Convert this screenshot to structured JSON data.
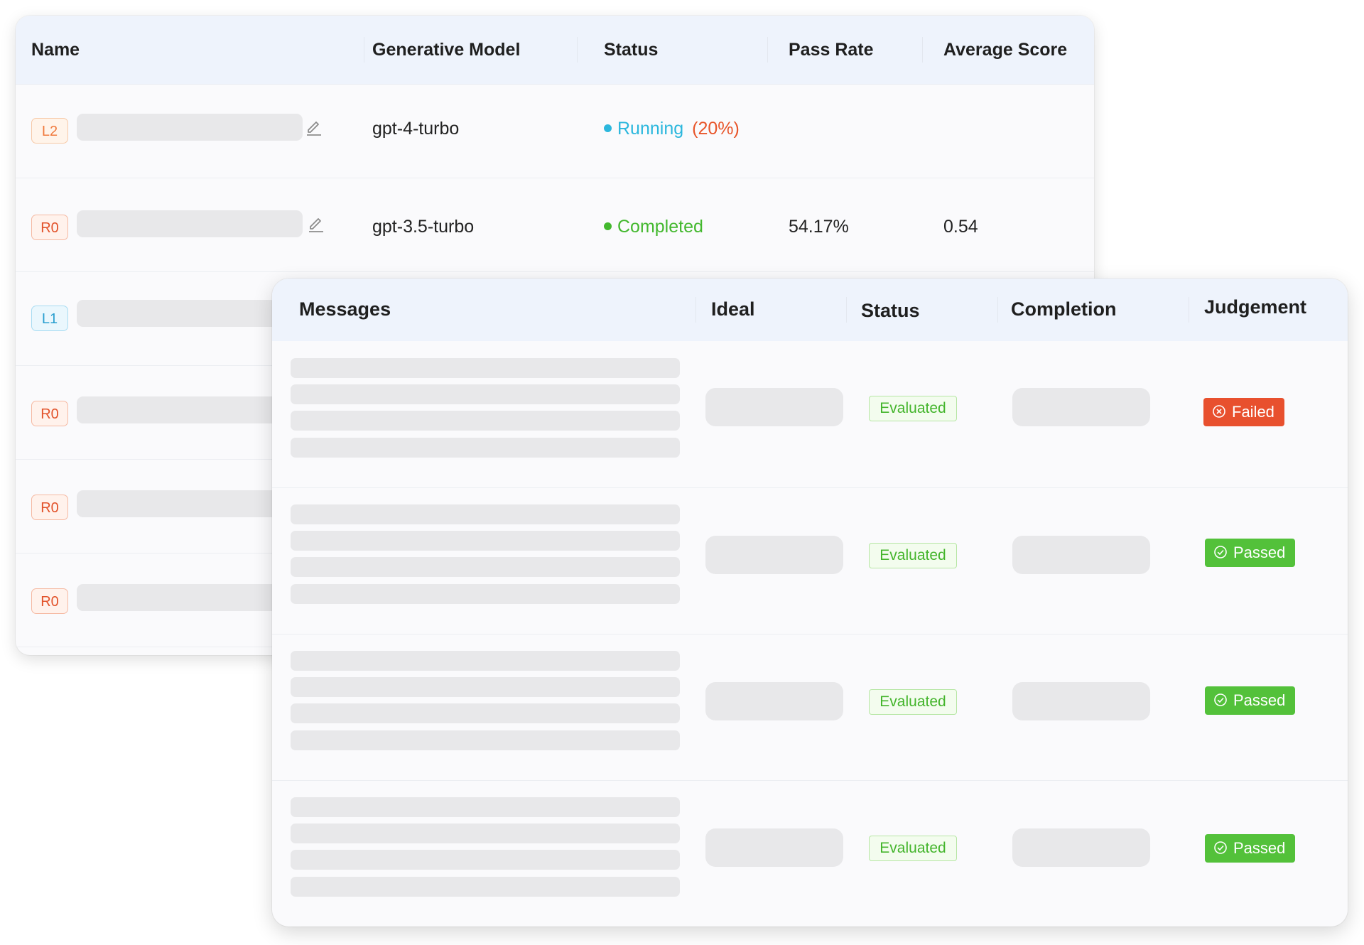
{
  "runs_table": {
    "columns": [
      "Name",
      "Generative Model",
      "Status",
      "Pass Rate",
      "Average Score"
    ],
    "rows": [
      {
        "level": "L2",
        "model": "gpt-4-turbo",
        "status": "Running",
        "progress": "(20%)",
        "pass_rate": "",
        "avg_score": ""
      },
      {
        "level": "R0",
        "model": "gpt-3.5-turbo",
        "status": "Completed",
        "progress": "",
        "pass_rate": "54.17%",
        "avg_score": "0.54"
      },
      {
        "level": "L1",
        "model": "",
        "status": "",
        "progress": "",
        "pass_rate": "",
        "avg_score": ""
      },
      {
        "level": "R0",
        "model": "",
        "status": "",
        "progress": "",
        "pass_rate": "",
        "avg_score": ""
      },
      {
        "level": "R0",
        "model": "",
        "status": "",
        "progress": "",
        "pass_rate": "",
        "avg_score": ""
      },
      {
        "level": "R0",
        "model": "",
        "status": "",
        "progress": "",
        "pass_rate": "",
        "avg_score": ""
      }
    ]
  },
  "messages_table": {
    "columns": [
      "Messages",
      "Ideal",
      "Status",
      "Completion",
      "Judgement"
    ],
    "rows": [
      {
        "status": "Evaluated",
        "judgement": "Failed"
      },
      {
        "status": "Evaluated",
        "judgement": "Passed"
      },
      {
        "status": "Evaluated",
        "judgement": "Passed"
      },
      {
        "status": "Evaluated",
        "judgement": "Passed"
      }
    ]
  },
  "colors": {
    "running": "#2bb7dd",
    "progress": "#e8552a",
    "completed": "#43b82e",
    "failed": "#e8502e",
    "passed": "#53c13a",
    "evaluated": "#44b52c",
    "header_bg": "#eef3fc",
    "skeleton": "#e8e8ea"
  },
  "icons": {
    "edit": "pencil-icon",
    "failed": "x-circle-icon",
    "passed": "check-circle-icon"
  }
}
